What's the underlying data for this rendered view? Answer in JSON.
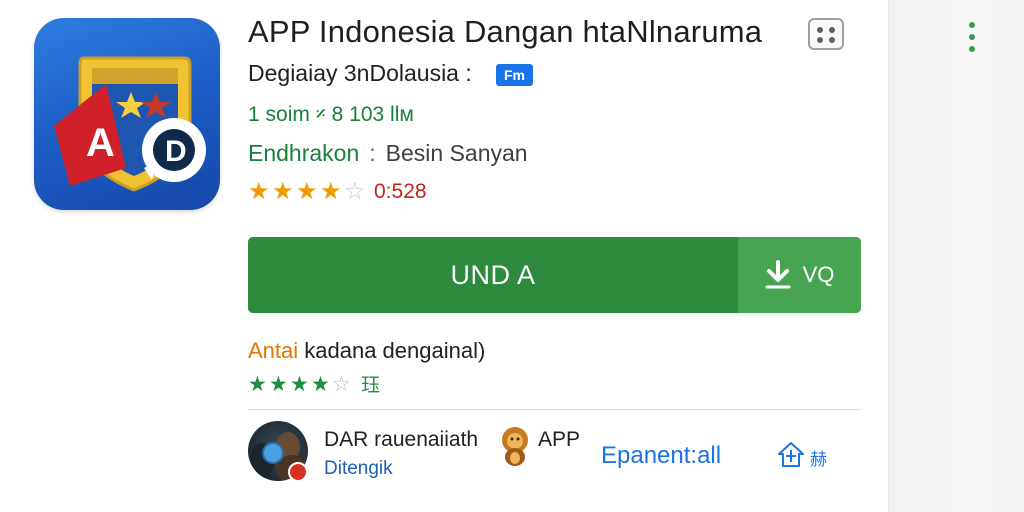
{
  "app": {
    "title": "APP Indonesia Dangan htaNlnaruma",
    "developer": "Degiaiay 3nDolausia :",
    "developer_tag": "Fm",
    "meta_line": "1 soim 𝄎 8  103 llм",
    "category_label": "Endhrakon",
    "category_sep": ":",
    "category_value": "Besin Sanyan",
    "rating": {
      "stars_filled": 4,
      "stars_total": 5,
      "count_text": "0:528"
    },
    "icon": "app-shield-icon"
  },
  "install": {
    "primary_label": "UND A",
    "secondary_label": "VQ",
    "secondary_icon": "download-icon",
    "colors": {
      "primary": "#2e8a3c",
      "secondary": "#47a552"
    }
  },
  "review_section": {
    "heading_accent": "Antai",
    "heading_rest": " kadana dengainal)",
    "stars_filled": 4,
    "stars_total": 5,
    "code": "珏"
  },
  "reviewer": {
    "name": "DAR rauenaiiath",
    "subtitle": "Ditengik",
    "app_label": "APP",
    "mascot_icon": "lion-mascot-icon",
    "expand_link": "Epanent:all",
    "share_label": "赫",
    "share_icon": "share-icon"
  },
  "menu": {
    "icon": "overflow-menu-icon"
  },
  "colors": {
    "accent_green": "#188038",
    "star_orange": "#f29900",
    "link_blue": "#1a73e8",
    "count_red": "#c5221f"
  }
}
